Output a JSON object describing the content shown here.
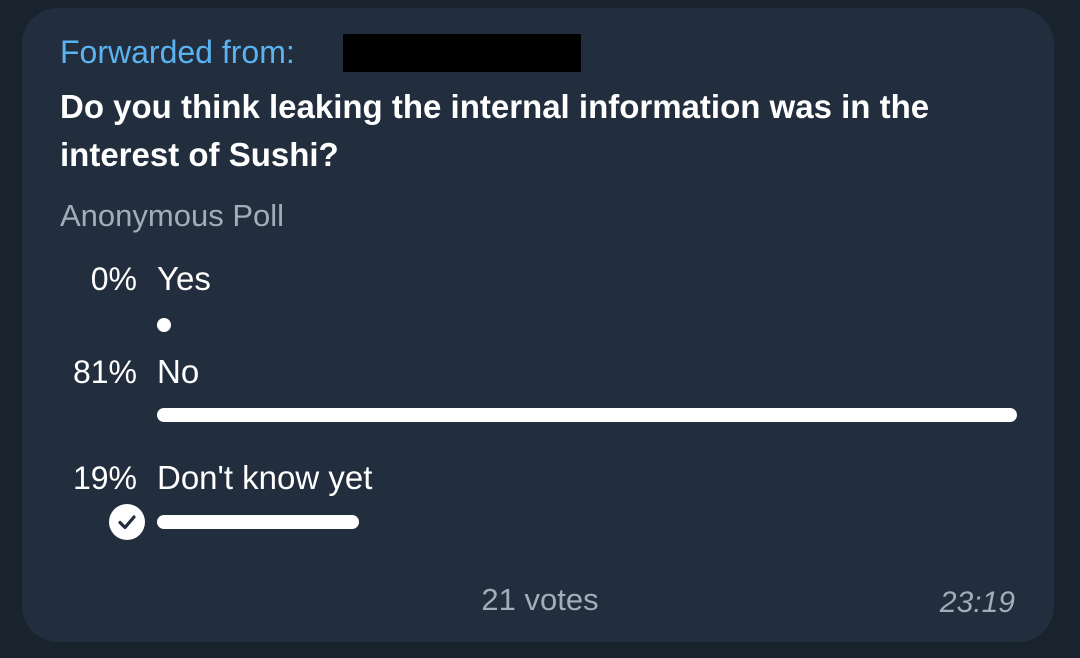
{
  "message": {
    "forwarded_label": "Forwarded from:",
    "question": "Do you think leaking the internal information was in the interest of Sushi?",
    "poll_type": "Anonymous Poll",
    "options": [
      {
        "percent_text": "0%",
        "label": "Yes",
        "fraction": 0.0,
        "selected": false
      },
      {
        "percent_text": "81%",
        "label": "No",
        "fraction": 0.81,
        "selected": false
      },
      {
        "percent_text": "19%",
        "label": "Don't know yet",
        "fraction": 0.19,
        "selected": true
      }
    ],
    "votes": "21 votes",
    "time": "23:19"
  },
  "colors": {
    "background": "#19232d",
    "bubble": "#222e3d",
    "accent": "#5ab3f0",
    "text": "#ffffff",
    "secondary_text": "#a3adb8",
    "bar": "#ffffff"
  },
  "icons": {
    "selected_option": "check-circle-icon"
  }
}
